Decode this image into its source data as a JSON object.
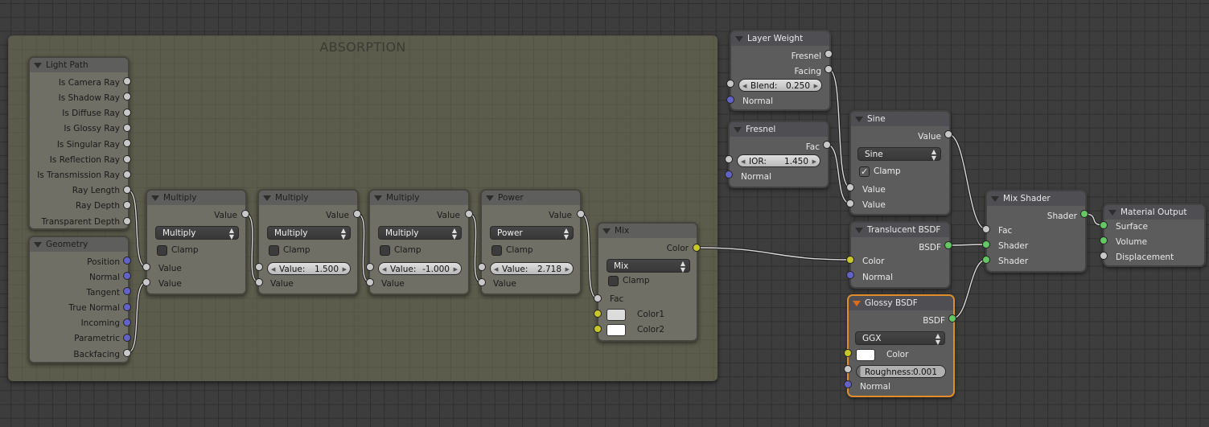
{
  "frame": {
    "label": "ABSORPTION"
  },
  "nodes": {
    "light_path": {
      "title": "Light Path",
      "outputs": [
        "Is Camera Ray",
        "Is Shadow Ray",
        "Is Diffuse Ray",
        "Is Glossy Ray",
        "Is Singular Ray",
        "Is Reflection Ray",
        "Is Transmission Ray",
        "Ray Length",
        "Ray Depth",
        "Transparent Depth"
      ]
    },
    "geometry": {
      "title": "Geometry",
      "outputs": [
        "Position",
        "Normal",
        "Tangent",
        "True Normal",
        "Incoming",
        "Parametric",
        "Backfacing"
      ]
    },
    "multiply1": {
      "title": "Multiply",
      "output": "Value",
      "operation": "Multiply",
      "clamp_label": "Clamp",
      "inputs": [
        "Value",
        "Value"
      ]
    },
    "multiply2": {
      "title": "Multiply",
      "output": "Value",
      "operation": "Multiply",
      "clamp_label": "Clamp",
      "field_label": "Value:",
      "field_value": "1.500",
      "input": "Value"
    },
    "multiply3": {
      "title": "Multiply",
      "output": "Value",
      "operation": "Multiply",
      "clamp_label": "Clamp",
      "field_label": "Value:",
      "field_value": "-1.000",
      "input": "Value"
    },
    "power": {
      "title": "Power",
      "output": "Value",
      "operation": "Power",
      "clamp_label": "Clamp",
      "field_label": "Value:",
      "field_value": "2.718",
      "input": "Value"
    },
    "mix": {
      "title": "Mix",
      "output": "Color",
      "blend": "Mix",
      "clamp_label": "Clamp",
      "fac": "Fac",
      "color1": "Color1",
      "color2": "Color2",
      "color1_hex": "#dcdcdc",
      "color2_hex": "#ffffff"
    },
    "layer_weight": {
      "title": "Layer Weight",
      "outputs": [
        "Fresnel",
        "Facing"
      ],
      "field_label": "Blend:",
      "field_value": "0.250",
      "normal": "Normal"
    },
    "fresnel": {
      "title": "Fresnel",
      "output": "Fac",
      "field_label": "IOR:",
      "field_value": "1.450",
      "normal": "Normal"
    },
    "sine": {
      "title": "Sine",
      "output": "Value",
      "operation": "Sine",
      "clamp_label": "Clamp",
      "clamp_checked": true,
      "inputs": [
        "Value",
        "Value"
      ]
    },
    "translucent": {
      "title": "Translucent BSDF",
      "output": "BSDF",
      "inputs": [
        "Color",
        "Normal"
      ]
    },
    "glossy": {
      "title": "Glossy BSDF",
      "output": "BSDF",
      "distribution": "GGX",
      "color_label": "Color",
      "color_hex": "#ffffff",
      "field_label": "Roughness:",
      "field_value": "0.001",
      "roughness": 0.001,
      "normal": "Normal"
    },
    "mix_shader": {
      "title": "Mix Shader",
      "output": "Shader",
      "inputs": [
        "Fac",
        "Shader",
        "Shader"
      ]
    },
    "material_output": {
      "title": "Material Output",
      "inputs": [
        "Surface",
        "Volume",
        "Displacement"
      ]
    }
  },
  "colors": {
    "active_node": "#e28d2c",
    "frame": "#5c5c4c",
    "socket_value": "#c8c8c8",
    "socket_vector": "#6363c7",
    "socket_color": "#c8c72a",
    "socket_shader": "#63c763"
  }
}
